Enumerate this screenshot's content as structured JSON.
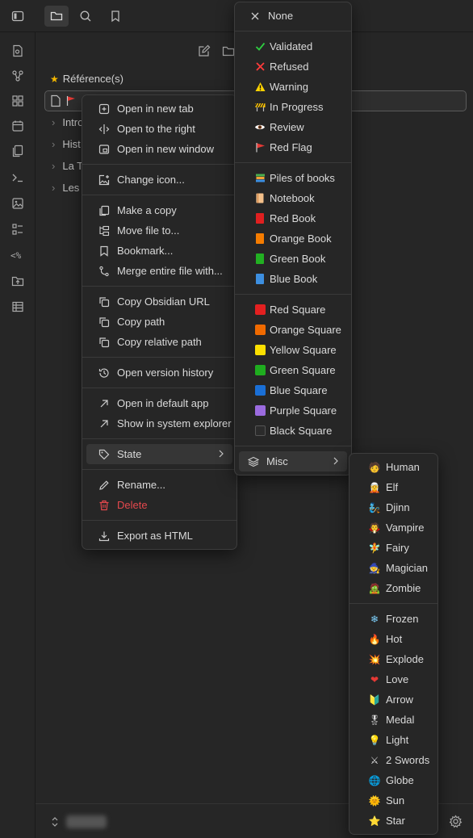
{
  "explorer": {
    "section_title": "Référence(s)",
    "folders": [
      "Intro",
      "Hist",
      "La T",
      "Les"
    ]
  },
  "context_menu": {
    "items": [
      {
        "label": "Open in new tab",
        "icon": "new-tab-icon"
      },
      {
        "label": "Open to the right",
        "icon": "split-right-icon"
      },
      {
        "label": "Open in new window",
        "icon": "new-window-icon"
      },
      {
        "label": "Change icon...",
        "icon": "image-plus-icon"
      },
      {
        "label": "Make a copy",
        "icon": "copy-file-icon"
      },
      {
        "label": "Move file to...",
        "icon": "move-file-icon"
      },
      {
        "label": "Bookmark...",
        "icon": "bookmark-icon"
      },
      {
        "label": "Merge entire file with...",
        "icon": "merge-icon"
      },
      {
        "label": "Copy Obsidian URL",
        "icon": "copy-icon"
      },
      {
        "label": "Copy path",
        "icon": "copy-icon"
      },
      {
        "label": "Copy relative path",
        "icon": "copy-icon"
      },
      {
        "label": "Open version history",
        "icon": "history-icon"
      },
      {
        "label": "Open in default app",
        "icon": "external-arrow-icon"
      },
      {
        "label": "Show in system explorer",
        "icon": "external-arrow-icon"
      },
      {
        "label": "State",
        "icon": "tag-icon"
      },
      {
        "label": "Rename...",
        "icon": "pencil-icon"
      },
      {
        "label": "Delete",
        "icon": "trash-icon"
      },
      {
        "label": "Export as HTML",
        "icon": "download-icon"
      }
    ]
  },
  "state_menu": {
    "none": "None",
    "status": [
      {
        "label": "Validated",
        "icon": "check-icon",
        "color": "#2ecc40"
      },
      {
        "label": "Refused",
        "icon": "cross-icon",
        "color": "#ff3b3b"
      },
      {
        "label": "Warning",
        "icon": "warning-icon",
        "color": "#ffd400"
      },
      {
        "label": "In Progress",
        "icon": "construction-icon",
        "color": "#ffc400"
      },
      {
        "label": "Review",
        "icon": "eye-icon",
        "color": "#ffffff"
      },
      {
        "label": "Red Flag",
        "icon": "red-flag-icon",
        "color": "#e53935"
      }
    ],
    "books": [
      {
        "label": "Piles of books",
        "icon": "books-icon",
        "color": "#4caf50"
      },
      {
        "label": "Notebook",
        "icon": "notebook-icon",
        "color": "#f4c08a"
      },
      {
        "label": "Red Book",
        "icon": "book-icon",
        "color": "#e02020"
      },
      {
        "label": "Orange Book",
        "icon": "book-icon",
        "color": "#f57c00"
      },
      {
        "label": "Green Book",
        "icon": "book-icon",
        "color": "#22b022"
      },
      {
        "label": "Blue Book",
        "icon": "book-icon",
        "color": "#3d8fe0"
      }
    ],
    "squares": [
      {
        "label": "Red Square",
        "color": "#e32020"
      },
      {
        "label": "Orange Square",
        "color": "#f06a00"
      },
      {
        "label": "Yellow Square",
        "color": "#fce000"
      },
      {
        "label": "Green Square",
        "color": "#1fad1f"
      },
      {
        "label": "Blue Square",
        "color": "#1a6fd6"
      },
      {
        "label": "Purple Square",
        "color": "#9b6bdf"
      },
      {
        "label": "Black Square",
        "color": "#2b2b2b"
      }
    ],
    "misc": "Misc"
  },
  "misc_menu": {
    "characters": [
      {
        "label": "Human",
        "emoji": "🧑"
      },
      {
        "label": "Elf",
        "emoji": "🧝"
      },
      {
        "label": "Djinn",
        "emoji": "🧞"
      },
      {
        "label": "Vampire",
        "emoji": "🧛"
      },
      {
        "label": "Fairy",
        "emoji": "🧚"
      },
      {
        "label": "Magician",
        "emoji": "🧙"
      },
      {
        "label": "Zombie",
        "emoji": "🧟"
      }
    ],
    "symbols": [
      {
        "label": "Frozen",
        "emoji": "❄"
      },
      {
        "label": "Hot",
        "emoji": "🔥"
      },
      {
        "label": "Explode",
        "emoji": "💥"
      },
      {
        "label": "Love",
        "emoji": "❤"
      },
      {
        "label": "Arrow",
        "emoji": "🔰"
      },
      {
        "label": "Medal",
        "emoji": "🎖"
      },
      {
        "label": "Light",
        "emoji": "💡"
      },
      {
        "label": "2 Swords",
        "emoji": "⚔"
      },
      {
        "label": "Globe",
        "emoji": "🌐"
      },
      {
        "label": "Sun",
        "emoji": "🌞"
      },
      {
        "label": "Star",
        "emoji": "⭐"
      }
    ]
  }
}
